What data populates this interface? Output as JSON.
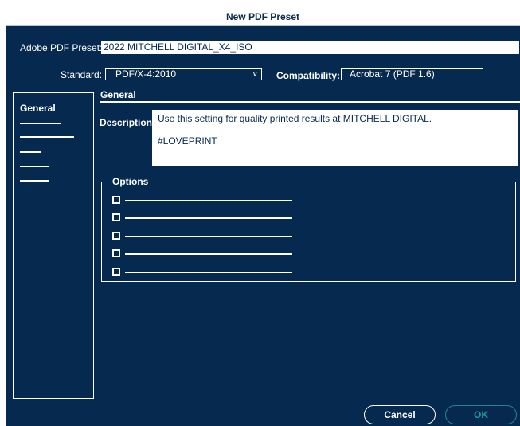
{
  "window": {
    "title": "New PDF Preset"
  },
  "preset": {
    "label": "Adobe PDF Preset:",
    "value": "2022 MITCHELL DIGITAL_X4_ISO"
  },
  "standard": {
    "label": "Standard:",
    "value": "PDF/X-4:2010"
  },
  "compatibility": {
    "label": "Compatibility:",
    "value": "Acrobat 7 (PDF 1.6)"
  },
  "sidebar": {
    "selected_label": "General"
  },
  "general": {
    "section_title": "General",
    "description_label": "Description:",
    "description_line1": "Use this setting for quality printed results at MITCHELL DIGITAL.",
    "description_line2": "#LOVEPRINT"
  },
  "options": {
    "legend": "Options",
    "count": 5
  },
  "buttons": {
    "cancel": "Cancel",
    "ok": "OK"
  },
  "colors": {
    "background": "#062a4f",
    "text": "#ffffff",
    "ok_accent": "#1f9e96"
  }
}
